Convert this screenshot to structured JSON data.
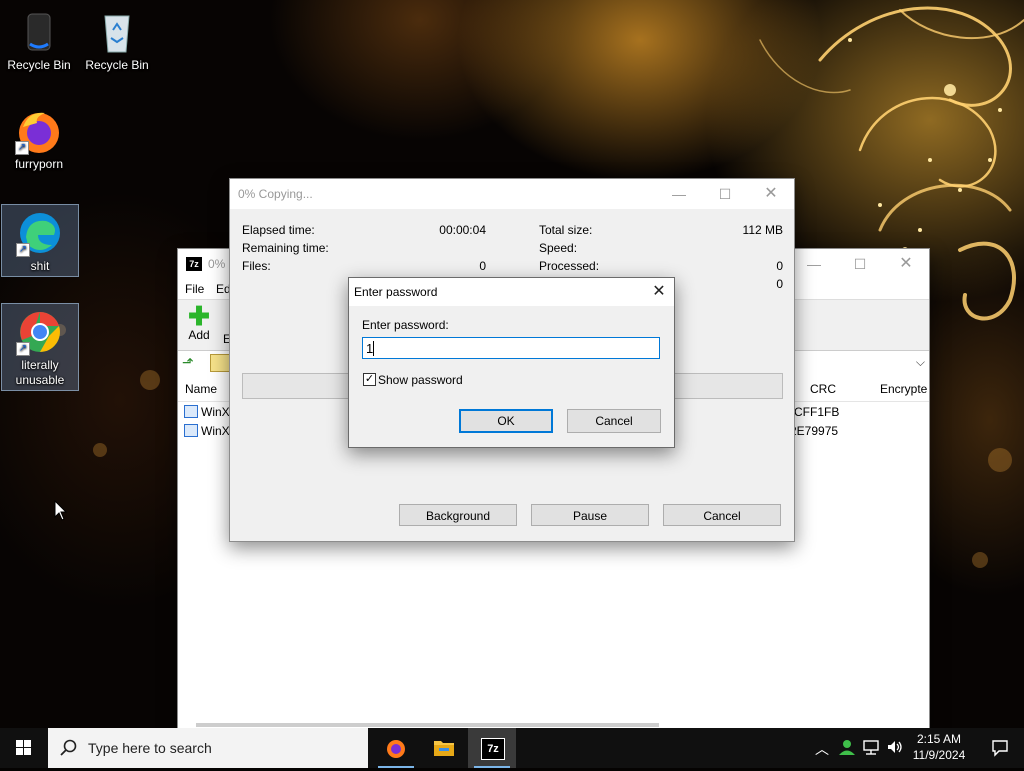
{
  "desktop": {
    "icons": [
      {
        "label": "Recycle Bin",
        "icon": "speaker-icon"
      },
      {
        "label": "Recycle Bin",
        "icon": "recycle-bin-icon"
      },
      {
        "label": "furryporn",
        "icon": "firefox-icon"
      },
      {
        "label": "shit",
        "icon": "edge-icon"
      },
      {
        "label": "literally unusable",
        "icon": "chrome-icon"
      }
    ]
  },
  "sevenzip_window": {
    "title_prefix": "0% C",
    "menu": {
      "file": "File",
      "edit": "Ed"
    },
    "toolbar": {
      "add": "Add",
      "extract_partial": "E"
    },
    "columns": {
      "name": "Name",
      "crc": "CRC",
      "encrypted": "Encrypte"
    },
    "rows": [
      {
        "name": "WinX",
        "crc": "CFF1FB"
      },
      {
        "name": "WinX",
        "crc": "2E79975"
      }
    ]
  },
  "copy_dialog": {
    "title": "0% Copying...",
    "left_labels": {
      "elapsed": "Elapsed time:",
      "remaining": "Remaining time:",
      "files": "Files:"
    },
    "left_values": {
      "elapsed": "00:00:04",
      "remaining": "",
      "files": "0"
    },
    "right_labels": {
      "total_size": "Total size:",
      "speed": "Speed:",
      "processed": "Processed:"
    },
    "right_values": {
      "total_size": "112 MB",
      "speed": "",
      "processed": "0",
      "fourth": "0"
    },
    "progress": 0,
    "buttons": {
      "background": "Background",
      "pause": "Pause",
      "cancel": "Cancel"
    }
  },
  "password_dialog": {
    "title": "Enter password",
    "prompt": "Enter password:",
    "value": "1",
    "show_password_label": "Show password",
    "show_password_checked": true,
    "ok": "OK",
    "cancel": "Cancel"
  },
  "taskbar": {
    "search_placeholder": "Type here to search",
    "apps": [
      "firefox-icon",
      "file-explorer-icon",
      "7zip-icon"
    ],
    "sevenzip_label": "7z",
    "time": "2:15 AM",
    "date": "11/9/2024"
  },
  "colors": {
    "accent": "#0078d7",
    "taskbar": "#101010",
    "sevenzip_green": "#2bb52b"
  }
}
